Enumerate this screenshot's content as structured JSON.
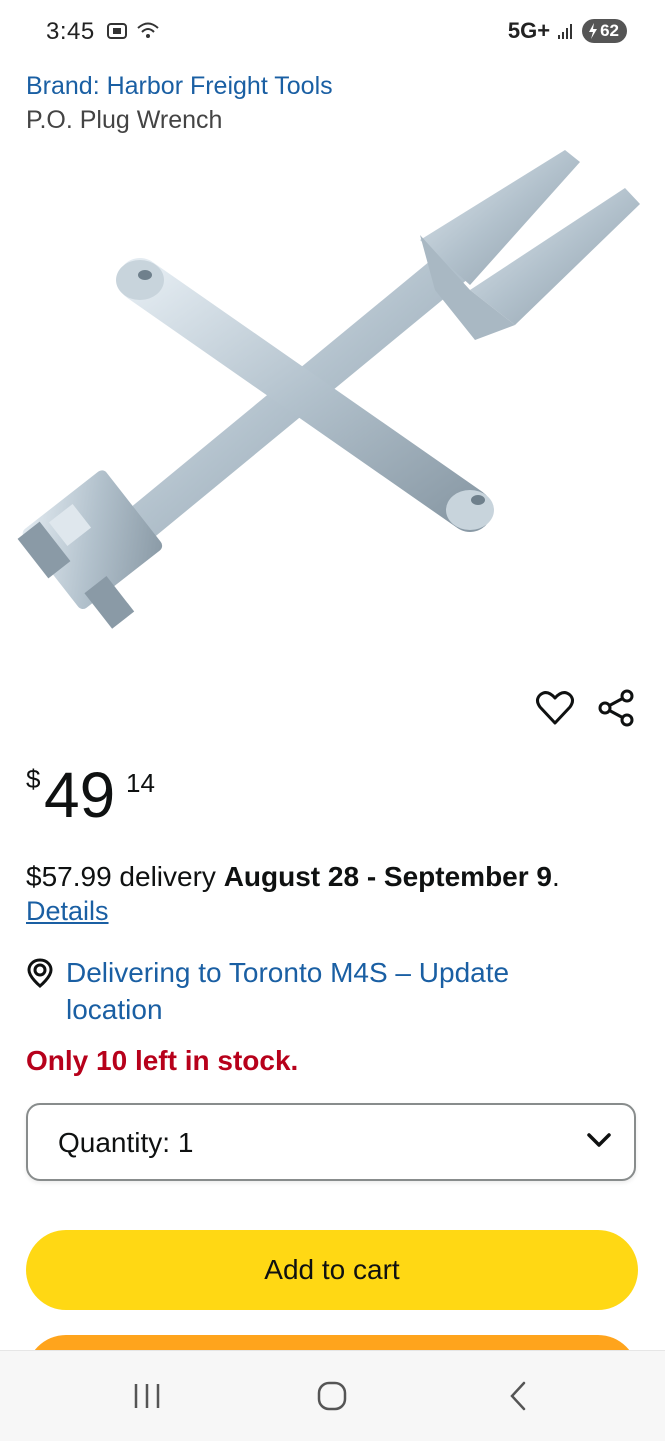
{
  "status": {
    "time": "3:45",
    "network": "5G+",
    "battery": "62"
  },
  "product": {
    "brand_link": "Brand: Harbor Freight Tools",
    "title": "P.O. Plug Wrench"
  },
  "price": {
    "symbol": "$",
    "whole": "49",
    "fraction": "14"
  },
  "delivery": {
    "prefix": "$57.99 delivery ",
    "dates": "August 28 - September 9",
    "suffix": ".",
    "details_link": "Details"
  },
  "location": {
    "text": "Delivering to Toronto M4S – Update location"
  },
  "stock": {
    "text": "Only 10 left in stock."
  },
  "quantity": {
    "label": "Quantity:",
    "value": "1"
  },
  "buttons": {
    "add_to_cart": "Add to cart"
  },
  "colors": {
    "link": "#1a5fa3",
    "stock_alert": "#b7011b",
    "add_to_cart": "#ffd814",
    "buy_now": "#ffa41c"
  },
  "icons": {
    "wishlist": "heart-icon",
    "share": "share-icon",
    "location": "location-pin-icon",
    "dropdown": "chevron-down-icon"
  }
}
